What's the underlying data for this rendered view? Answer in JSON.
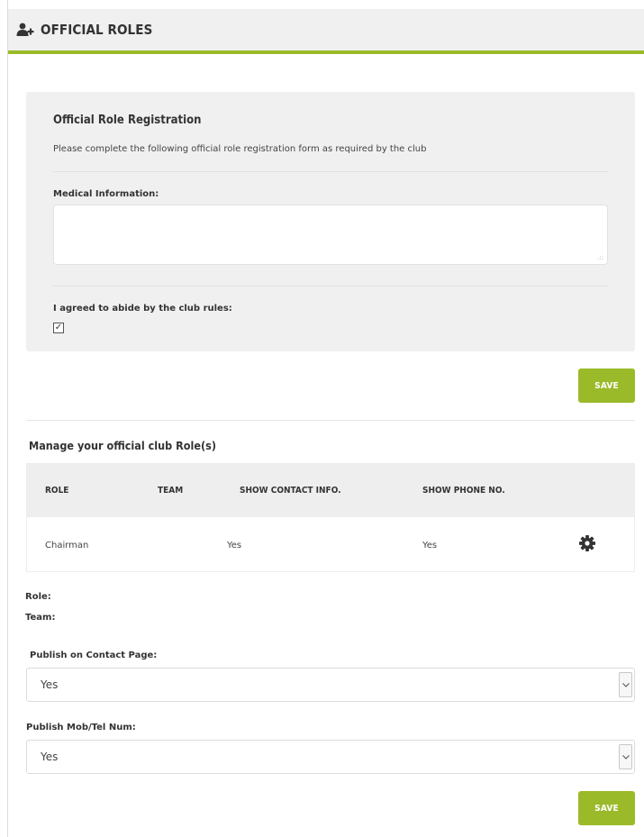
{
  "header": {
    "title": "OFFICIAL ROLES",
    "icon": "add-user-icon",
    "accent_color": "#9bba2a"
  },
  "registration": {
    "title": "Official Role Registration",
    "description": "Please complete the following official role registration form as required by the club",
    "medical_label": "Medical Information:",
    "medical_value": "",
    "rules_label": "I agreed to abide by the club rules:",
    "rules_checked": true,
    "save_label": "SAVE"
  },
  "manage": {
    "title": "Manage your official club Role(s)",
    "columns": [
      "ROLE",
      "TEAM",
      "SHOW CONTACT INFO.",
      "SHOW PHONE NO."
    ],
    "rows": [
      {
        "role": "Chairman",
        "team": "",
        "show_contact": "Yes",
        "show_phone": "Yes",
        "action_icon": "gear-icon"
      }
    ]
  },
  "details": {
    "role_label": "Role:",
    "team_label": "Team:",
    "publish_contact_label": "Publish on Contact Page:",
    "publish_contact_value": "Yes",
    "publish_mob_label": "Publish Mob/Tel Num:",
    "publish_mob_value": "Yes",
    "save_label": "SAVE"
  }
}
